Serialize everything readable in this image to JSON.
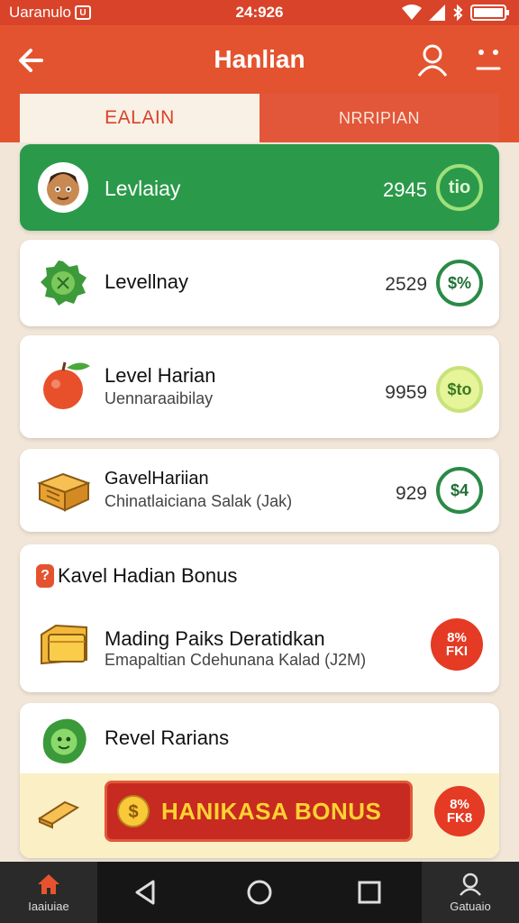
{
  "status_bar": {
    "carrier": "Uaranulo",
    "sim_label": "U",
    "time": "24:926"
  },
  "app_bar": {
    "title": "Hanlian"
  },
  "tabs": [
    {
      "label": "EALAIN"
    },
    {
      "label": "NRRIPIAN"
    }
  ],
  "cards": [
    {
      "title": "Levlaiay",
      "value": "2945",
      "badge": "tio"
    },
    {
      "title": "Levellnay",
      "value": "2529",
      "badge": "$%"
    },
    {
      "title": "Level Harian",
      "subtitle": "Uennaraaibilay",
      "value": "9959",
      "badge": "$to"
    },
    {
      "title": "GavelHariian",
      "subtitle": "Chinatlaiciana Salak (Jak)",
      "value": "929",
      "badge": "$4"
    }
  ],
  "bonus_section": {
    "heading": "Kavel Hadian Bonus",
    "title": "Mading Paiks Deratidkan",
    "subtitle": "Emapaltian Cdehunana Kalad (J2M)",
    "badge_top": "8%",
    "badge_bottom": "FKI"
  },
  "last_card": {
    "title": "Revel Rarians",
    "bonus_button": "HANIKASA BONUS",
    "badge_top": "8%",
    "badge_bottom": "FK8"
  },
  "bottom_nav": {
    "home_label": "Iaaiuiae",
    "profile_label": "Gatuaio"
  },
  "colors": {
    "primary": "#e4532f",
    "success": "#2a9a4a",
    "background": "#f1e6d8",
    "bonus_red": "#c72a20",
    "bonus_yellow": "#ffd232"
  }
}
